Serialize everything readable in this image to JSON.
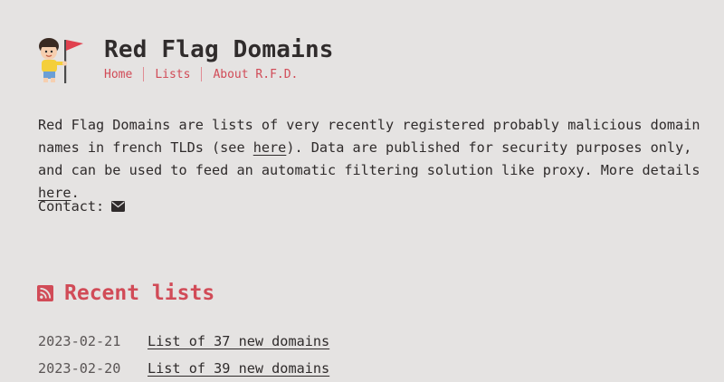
{
  "site": {
    "title": "Red Flag Domains",
    "logo_icon": "mascot-flag-icon"
  },
  "nav": {
    "items": [
      {
        "label": "Home"
      },
      {
        "label": "Lists"
      },
      {
        "label": "About R.F.D."
      }
    ]
  },
  "intro": {
    "part1": "Red Flag Domains are lists of very recently registered probably malicious domain names in french TLDs (see ",
    "link1": "here",
    "part2": "). Data are published for security purposes only, and can be used to feed an automatic filtering solution like proxy. More details ",
    "link2": "here",
    "part3": "."
  },
  "contact": {
    "label": "Contact:",
    "icon": "envelope-icon"
  },
  "recent": {
    "title": "Recent lists",
    "icon": "rss-icon",
    "items": [
      {
        "date": "2023-02-21",
        "label": "List of 37 new domains"
      },
      {
        "date": "2023-02-20",
        "label": "List of 39 new domains"
      }
    ]
  },
  "colors": {
    "background": "#e5e3e2",
    "accent": "#d14b57",
    "text": "#2f2b2b"
  }
}
